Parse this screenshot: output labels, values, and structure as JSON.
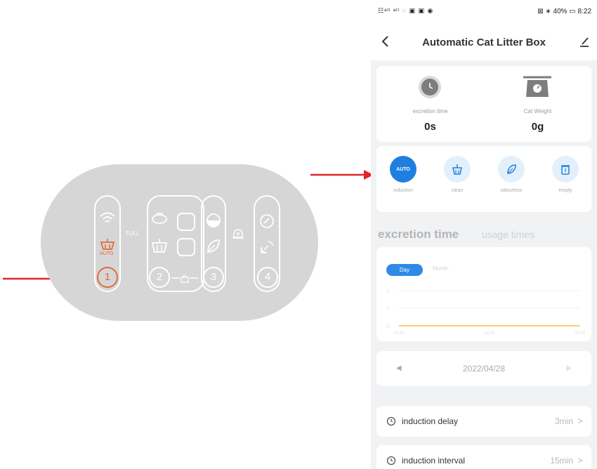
{
  "device_panel": {
    "full_label": "FULL",
    "auto_label": "AUTO",
    "buttons": [
      "1",
      "2",
      "3",
      "4"
    ],
    "accent_color": "#e06b3a"
  },
  "status_bar": {
    "left_icons": "☷ᵃᴵˡ ᵃᴵˡ ◌ ▣ ▣ ◉",
    "right": "⊠ ∗ 40% ▭ 8:22"
  },
  "header": {
    "title": "Automatic Cat Litter Box",
    "back_icon": "chevron-left-icon",
    "edit_icon": "edit-icon"
  },
  "stats": [
    {
      "label": "excretion time",
      "value": "0s",
      "icon": "clock-icon"
    },
    {
      "label": "Cat Weight",
      "value": "0g",
      "icon": "scale-icon"
    }
  ],
  "modes": [
    {
      "label": "induction",
      "icon_text": "AUTO",
      "active": true
    },
    {
      "label": "clean",
      "icon": "clean-icon",
      "active": false
    },
    {
      "label": "odourless",
      "icon": "leaf-icon",
      "active": false
    },
    {
      "label": "empty",
      "icon": "trash-icon",
      "active": false
    }
  ],
  "tabs": {
    "excretion": "excretion time",
    "usage": "usage times"
  },
  "chart_data": {
    "type": "line",
    "toggle": {
      "day": "Day",
      "month": "Month"
    },
    "y_ticks": [
      "2",
      "1",
      "0"
    ],
    "x_ticks": [
      "00:00",
      "04:00",
      "08:00"
    ],
    "x": [
      "00:00",
      "08:00"
    ],
    "values": [
      0,
      0
    ],
    "ylim": [
      0,
      2
    ],
    "line_color": "#f5c33b",
    "grid": true
  },
  "date_nav": {
    "prev": "◀",
    "date": "2022/04/28",
    "next": "▶"
  },
  "settings": [
    {
      "label": "induction delay",
      "value": "3min"
    },
    {
      "label": "induction interval",
      "value": "15min"
    }
  ],
  "chevron": ">",
  "annotation_color": "#e3242b"
}
